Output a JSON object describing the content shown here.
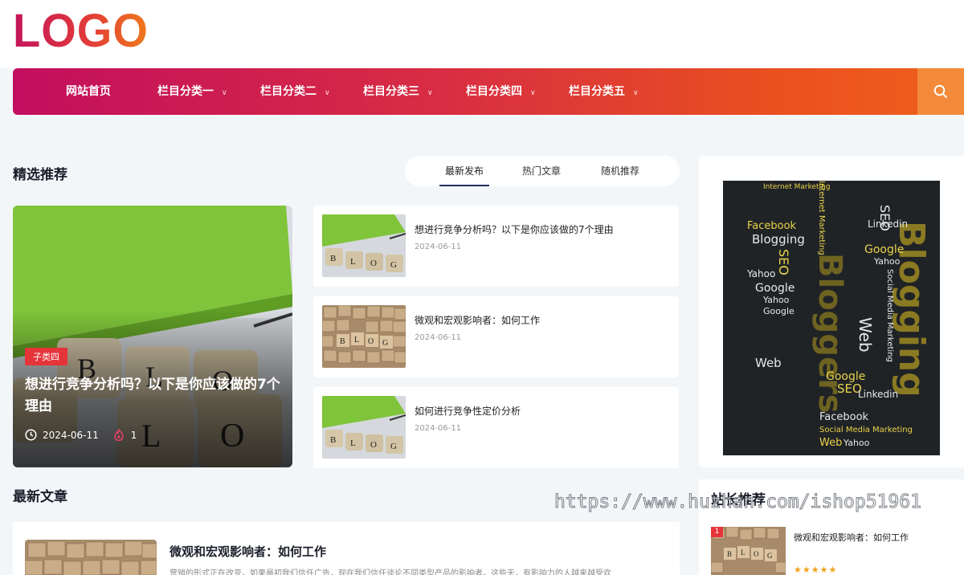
{
  "header": {
    "logo_text": "LOGO"
  },
  "nav": {
    "items": [
      {
        "label": "网站首页",
        "has_dropdown": false
      },
      {
        "label": "栏目分类一",
        "has_dropdown": true
      },
      {
        "label": "栏目分类二",
        "has_dropdown": true
      },
      {
        "label": "栏目分类三",
        "has_dropdown": true
      },
      {
        "label": "栏目分类四",
        "has_dropdown": true
      },
      {
        "label": "栏目分类五",
        "has_dropdown": true
      }
    ],
    "search_icon": "search-icon"
  },
  "featured": {
    "section_title": "精选推荐",
    "tabs": [
      {
        "label": "最新发布",
        "active": true
      },
      {
        "label": "热门文章",
        "active": false
      },
      {
        "label": "随机推荐",
        "active": false
      }
    ],
    "main": {
      "category": "子类四",
      "title": "想进行竞争分析吗？以下是你应该做的7个理由",
      "date": "2024-06-11",
      "likes": "1"
    },
    "list": [
      {
        "title": "想进行竞争分析吗？以下是你应该做的7个理由",
        "date": "2024-06-11",
        "thumb": "blog-dice-green"
      },
      {
        "title": "微观和宏观影响者：如何工作",
        "date": "2024-06-11",
        "thumb": "blog-dice-wood"
      },
      {
        "title": "如何进行竞争性定价分析",
        "date": "2024-06-11",
        "thumb": "blog-dice-green"
      }
    ]
  },
  "latest": {
    "section_title": "最新文章",
    "article": {
      "title": "微观和宏观影响者：如何工作",
      "excerpt": "营销的形式正在改变。如果最初我们信任广告，现在我们信任谈论不同类型产品的影响者。这些天，有影响力的人越来越受欢"
    }
  },
  "sidebar": {
    "ad_image": "blogging-word-cloud",
    "recommend_title": "站长推荐",
    "recommend": [
      {
        "rank": "1",
        "title": "微观和宏观影响者：如何工作",
        "stars": "★★★★★"
      }
    ]
  },
  "watermark": "https://www.huzhan.com/ishop51961",
  "colors": {
    "brand_start": "#c20e5e",
    "brand_end": "#f0601c",
    "badge": "#e5343a"
  }
}
